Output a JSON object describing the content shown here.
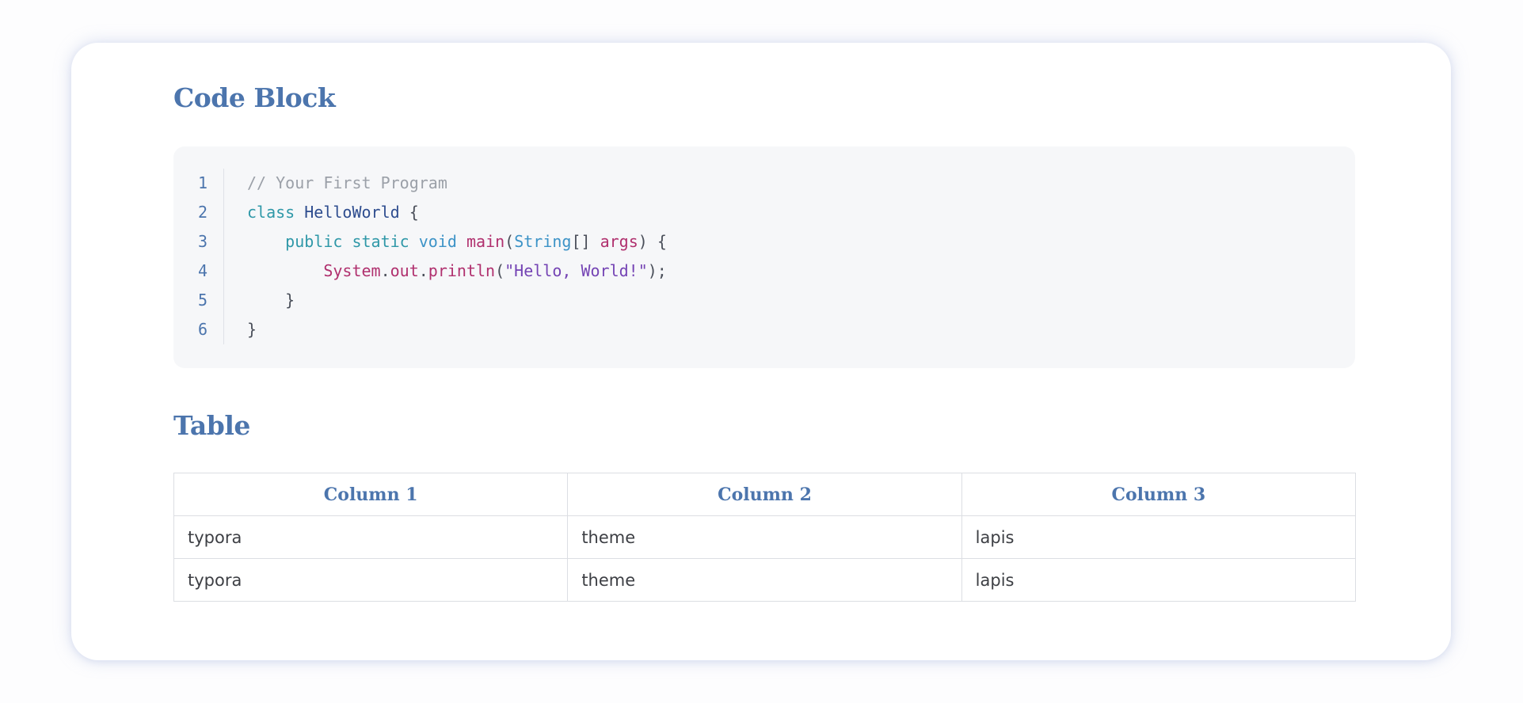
{
  "headings": {
    "code_block": "Code Block",
    "table": "Table"
  },
  "code": {
    "line_numbers": [
      "1",
      "2",
      "3",
      "4",
      "5",
      "6"
    ],
    "lines": [
      [
        {
          "t": "// Your First Program",
          "k": "comment"
        }
      ],
      [
        {
          "t": "class",
          "k": "kw"
        },
        {
          "t": " ",
          "k": "punc"
        },
        {
          "t": "HelloWorld",
          "k": "cls"
        },
        {
          "t": " {",
          "k": "punc"
        }
      ],
      [
        {
          "t": "    ",
          "k": "punc"
        },
        {
          "t": "public",
          "k": "kw"
        },
        {
          "t": " ",
          "k": "punc"
        },
        {
          "t": "static",
          "k": "kw"
        },
        {
          "t": " ",
          "k": "punc"
        },
        {
          "t": "void",
          "k": "kw2"
        },
        {
          "t": " ",
          "k": "punc"
        },
        {
          "t": "main",
          "k": "fn"
        },
        {
          "t": "(",
          "k": "punc"
        },
        {
          "t": "String",
          "k": "type"
        },
        {
          "t": "[] ",
          "k": "punc"
        },
        {
          "t": "args",
          "k": "fn"
        },
        {
          "t": ") {",
          "k": "punc"
        }
      ],
      [
        {
          "t": "        ",
          "k": "punc"
        },
        {
          "t": "System",
          "k": "fn"
        },
        {
          "t": ".",
          "k": "punc"
        },
        {
          "t": "out",
          "k": "fn"
        },
        {
          "t": ".",
          "k": "punc"
        },
        {
          "t": "println",
          "k": "fn"
        },
        {
          "t": "(",
          "k": "punc"
        },
        {
          "t": "\"Hello, World!\"",
          "k": "str"
        },
        {
          "t": ");",
          "k": "punc"
        }
      ],
      [
        {
          "t": "    }",
          "k": "punc"
        }
      ],
      [
        {
          "t": "}",
          "k": "punc"
        }
      ]
    ]
  },
  "table": {
    "headers": [
      "Column 1",
      "Column 2",
      "Column 3"
    ],
    "rows": [
      [
        "typora",
        "theme",
        "lapis"
      ],
      [
        "typora",
        "theme",
        "lapis"
      ]
    ]
  },
  "colors": {
    "heading": "#4c75ad",
    "code_bg": "#f6f7f9",
    "comment": "#9ba0a8",
    "keyword": "#2f98a8",
    "class_name": "#2e4d8f",
    "function": "#b0306e",
    "type": "#3c93c7",
    "string": "#7443b4"
  }
}
